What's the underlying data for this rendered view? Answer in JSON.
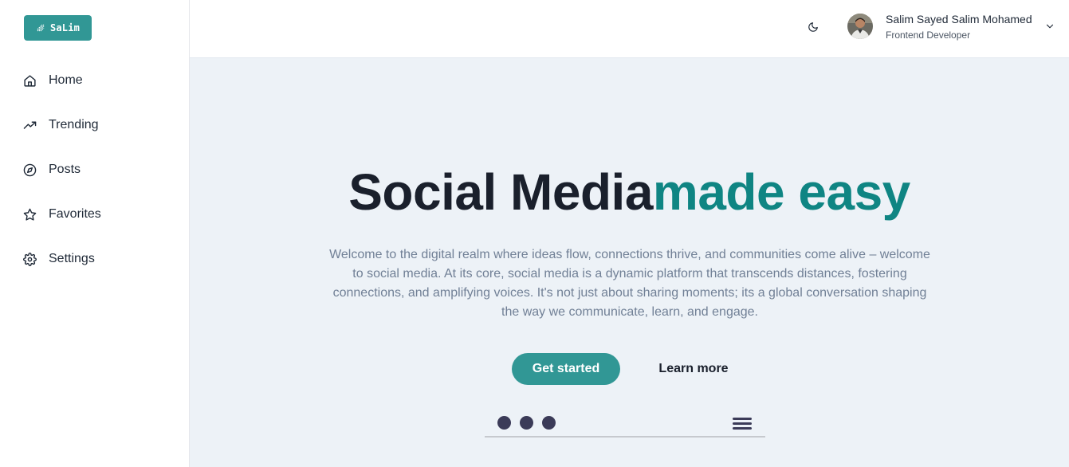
{
  "brand": {
    "name": "SaLim",
    "color": "#319795",
    "icon": "sparkle-logo-icon"
  },
  "sidebar": {
    "items": [
      {
        "label": "Home",
        "icon": "home-icon"
      },
      {
        "label": "Trending",
        "icon": "trending-up-icon"
      },
      {
        "label": "Posts",
        "icon": "compass-icon"
      },
      {
        "label": "Favorites",
        "icon": "star-icon"
      },
      {
        "label": "Settings",
        "icon": "gear-icon"
      }
    ]
  },
  "header": {
    "theme_toggle_icon": "moon-icon",
    "user": {
      "name": "Salim Sayed Salim Mohamed",
      "role": "Frontend Developer",
      "menu_icon": "chevron-down-icon"
    }
  },
  "hero": {
    "title_part1": "Social Media",
    "title_part2": "made easy",
    "accent_color": "#0f8583",
    "description": "Welcome to the digital realm where ideas flow, connections thrive, and communities come alive – welcome to social media. At its core, social media is a dynamic platform that transcends distances, fostering connections, and amplifying voices. It's not just about sharing moments; its a global conversation shaping the way we communicate, learn, and engage.",
    "primary_button": "Get started",
    "secondary_button": "Learn more"
  }
}
